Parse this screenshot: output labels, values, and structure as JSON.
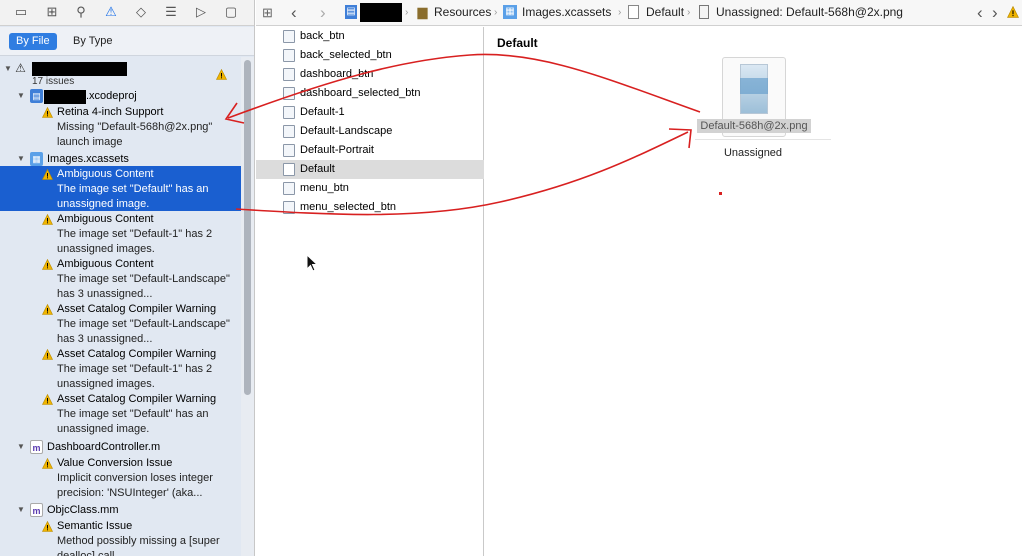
{
  "navigator": {
    "toolbar_icons": [
      "folder-icon",
      "hierarchy-icon",
      "search-icon",
      "warning-icon",
      "test-diamond-icon",
      "list-icon",
      "breakpoint-icon",
      "message-icon"
    ],
    "scope": {
      "by_file": "By File",
      "by_type": "By Type"
    },
    "project": {
      "issue_count": "17 issues"
    },
    "groups": [
      {
        "label": ".xcodeproj",
        "icon": "xcodeproj-icon",
        "issues": [
          {
            "title": "Retina 4-inch Support",
            "desc": "Missing \"Default-568h@2x.png\" launch image"
          }
        ]
      },
      {
        "label": "Images.xcassets",
        "icon": "asset-catalog-icon",
        "issues": [
          {
            "title": "Ambiguous Content",
            "desc": "The image set \"Default\" has an unassigned image.",
            "selected": true
          },
          {
            "title": "Ambiguous Content",
            "desc": "The image set \"Default-1\" has 2 unassigned images."
          },
          {
            "title": "Ambiguous Content",
            "desc": "The image set \"Default-Landscape\" has 3 unassigned..."
          },
          {
            "title": "Asset Catalog Compiler Warning",
            "desc": "The image set \"Default-Landscape\" has 3 unassigned..."
          },
          {
            "title": "Asset Catalog Compiler Warning",
            "desc": "The image set \"Default-1\" has 2 unassigned images."
          },
          {
            "title": "Asset Catalog Compiler Warning",
            "desc": "The image set \"Default\" has an unassigned image."
          }
        ]
      },
      {
        "label": "DashboardController.m",
        "icon": "objc-file-icon",
        "issues": [
          {
            "title": "Value Conversion Issue",
            "desc": "Implicit conversion loses integer precision: 'NSUInteger' (aka..."
          }
        ]
      },
      {
        "label": "ObjcClass.mm",
        "icon": "objc-file-icon",
        "issues": [
          {
            "title": "Semantic Issue",
            "desc": "Method possibly missing a [super dealloc] call"
          }
        ]
      }
    ]
  },
  "jump_bar": {
    "items": [
      "Resources",
      "Images.xcassets",
      "Default",
      "Unassigned: Default-568h@2x.png"
    ]
  },
  "assets": [
    {
      "label": "back_btn"
    },
    {
      "label": "back_selected_btn"
    },
    {
      "label": "dashboard_btn"
    },
    {
      "label": "dashboard_selected_btn"
    },
    {
      "label": "Default-1"
    },
    {
      "label": "Default-Landscape"
    },
    {
      "label": "Default-Portrait"
    },
    {
      "label": "Default",
      "selected": true
    },
    {
      "label": "menu_btn"
    },
    {
      "label": "menu_selected_btn"
    }
  ],
  "detail": {
    "title": "Default",
    "image_filename": "Default-568h@2x.png",
    "slot_label": "Unassigned"
  },
  "colors": {
    "selection_blue": "#1a5fd0",
    "warning_yellow": "#f0b400",
    "annotation_red": "#d82020",
    "scope_active": "#2f7de1"
  }
}
